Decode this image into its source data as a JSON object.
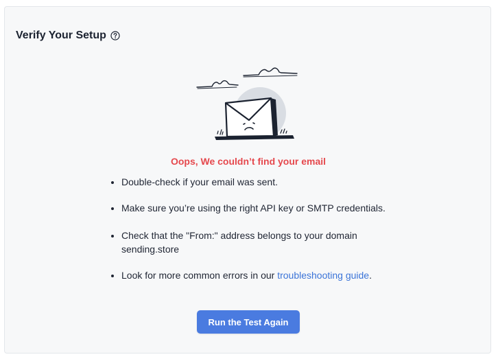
{
  "header": {
    "title": "Verify Your Setup",
    "help_icon": "question-circle-icon"
  },
  "illustration": {
    "icon": "sad-envelope-illustration"
  },
  "error": {
    "title": "Oops, We couldn’t find your email"
  },
  "tips": {
    "item1": "Double-check if your email was sent.",
    "item2": "Make sure you’re using the right API key or SMTP credentials.",
    "item3": "Check that the \"From:\" address belongs to your domain sending.store",
    "item4_prefix": "Look for more common errors in our ",
    "item4_link": "troubleshooting guide",
    "item4_suffix": "."
  },
  "actions": {
    "retry_label": "Run the Test Again"
  },
  "colors": {
    "error": "#e5484d",
    "link": "#3b74d8",
    "button": "#4a7be0"
  }
}
